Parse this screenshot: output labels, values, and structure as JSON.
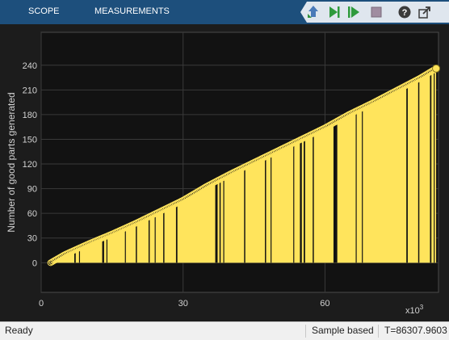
{
  "toolbar": {
    "tabs": [
      "SCOPE",
      "MEASUREMENTS"
    ],
    "buttons": [
      {
        "name": "highlight-simulink-block-button",
        "icon": "highlight-block-icon"
      },
      {
        "name": "step-forward-button",
        "icon": "step-forward-icon"
      },
      {
        "name": "run-button",
        "icon": "run-icon"
      },
      {
        "name": "stop-button",
        "icon": "stop-icon"
      },
      {
        "name": "help-button",
        "icon": "help-icon"
      },
      {
        "name": "undock-button",
        "icon": "undock-icon"
      }
    ]
  },
  "colors": {
    "toolbar": "#1d4f7c",
    "plot_background": "#121212",
    "figure_background": "#1c1c1c",
    "series": "#ffe45c",
    "grid": "#3a3a3a",
    "text": "#d2d2d2"
  },
  "chart_data": {
    "type": "area",
    "title": "",
    "xlabel": "",
    "ylabel": "Number of good parts generated",
    "x_exponent": "x10",
    "x_exponent_power": "3",
    "xlim": [
      0,
      84
    ],
    "ylim": [
      -36,
      280
    ],
    "xticks": [
      0,
      30,
      60
    ],
    "yticks": [
      0,
      30,
      60,
      90,
      120,
      150,
      180,
      210,
      240
    ],
    "grid": true,
    "legend": "none",
    "marker": "circle",
    "series": [
      {
        "x": [
          2,
          5,
          10,
          15,
          20,
          25,
          30,
          35,
          40,
          45,
          50,
          55,
          60,
          65,
          70,
          75,
          80,
          83.5
        ],
        "y": [
          0,
          10,
          23,
          35,
          48,
          62,
          76,
          93,
          108,
          122,
          136,
          150,
          164,
          180,
          194,
          209,
          224,
          236
        ]
      }
    ],
    "gaps": [
      [
        7,
        7.3
      ],
      [
        8,
        8.2
      ],
      [
        12.9,
        13.3
      ],
      [
        13.8,
        14
      ],
      [
        17.7,
        17.9
      ],
      [
        20,
        20.25
      ],
      [
        22.7,
        22.95
      ],
      [
        24,
        24.2
      ],
      [
        25.8,
        26.05
      ],
      [
        28.5,
        28.8
      ],
      [
        36.8,
        37.3
      ],
      [
        37.7,
        37.95
      ],
      [
        38.5,
        38.7
      ],
      [
        42.9,
        43.15
      ],
      [
        47.3,
        47.55
      ],
      [
        48.5,
        48.7
      ],
      [
        53.3,
        53.5
      ],
      [
        54.7,
        55.1
      ],
      [
        55.5,
        55.8
      ],
      [
        57.4,
        57.65
      ],
      [
        61.8,
        62.6
      ],
      [
        66.5,
        66.7
      ],
      [
        67.8,
        68
      ],
      [
        77.2,
        77.5
      ],
      [
        79.7,
        79.95
      ],
      [
        82.2,
        82.5
      ],
      [
        83,
        83.2
      ]
    ]
  },
  "status": {
    "state": "Ready",
    "mode": "Sample based",
    "time": "T=86307.9603"
  }
}
